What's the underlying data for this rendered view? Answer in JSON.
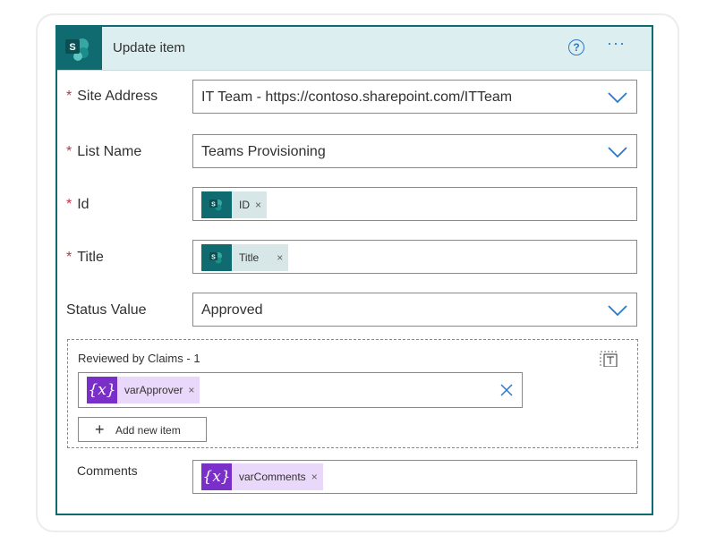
{
  "header": {
    "title": "Update item",
    "help_icon": "?",
    "more_icon": "···"
  },
  "fields": {
    "site_address": {
      "label": "Site Address",
      "required": "*",
      "value": "IT Team - https://contoso.sharepoint.com/ITTeam"
    },
    "list_name": {
      "label": "List Name",
      "required": "*",
      "value": "Teams Provisioning"
    },
    "id": {
      "label": "Id",
      "required": "*",
      "token": "ID",
      "token_remove": "×"
    },
    "title": {
      "label": "Title",
      "required": "*",
      "token": "Title",
      "token_remove": "×"
    },
    "status": {
      "label": "Status Value",
      "value": "Approved"
    }
  },
  "claims": {
    "title": "Reviewed by Claims - 1",
    "token": "varApprover",
    "token_glyph": "{x}",
    "token_remove": "×",
    "add_label": "Add new item",
    "add_glyph": "+"
  },
  "comments": {
    "label": "Comments",
    "token": "varComments",
    "token_glyph": "{x}",
    "token_remove": "×"
  },
  "colors": {
    "accent": "#0f6b6f",
    "link": "#2a78c7",
    "required": "#c4314b",
    "variable": "#7b2fc9"
  }
}
